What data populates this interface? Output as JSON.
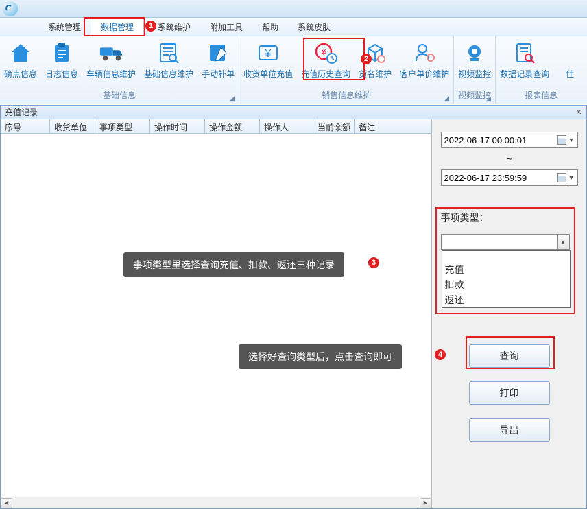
{
  "menubar": {
    "items": [
      {
        "label": "系统管理"
      },
      {
        "label": "数据管理",
        "active": true
      },
      {
        "label": "系统维护"
      },
      {
        "label": "附加工具"
      },
      {
        "label": "帮助"
      },
      {
        "label": "系统皮肤"
      }
    ]
  },
  "ribbon": {
    "groups": [
      {
        "label": "基础信息",
        "items": [
          {
            "label": "磅点信息",
            "icon": "home"
          },
          {
            "label": "日志信息",
            "icon": "clipboard"
          },
          {
            "label": "车辆信息维护",
            "icon": "truck"
          },
          {
            "label": "基础信息维护",
            "icon": "list"
          },
          {
            "label": "手动补单",
            "icon": "edit"
          }
        ]
      },
      {
        "label": "销售信息维护",
        "items": [
          {
            "label": "收货单位充值",
            "icon": "yen"
          },
          {
            "label": "充值历史查询",
            "icon": "yen-clock",
            "highlight": true
          },
          {
            "label": "货名维护",
            "icon": "package"
          },
          {
            "label": "客户单价维护",
            "icon": "person-gear"
          }
        ]
      },
      {
        "label": "视频监控",
        "items": [
          {
            "label": "视频监控",
            "icon": "camera"
          }
        ]
      },
      {
        "label": "报表信息",
        "items": [
          {
            "label": "数据记录查询",
            "icon": "doc-search"
          },
          {
            "label": "仕",
            "icon": "placeholder",
            "partial": true
          }
        ]
      }
    ]
  },
  "panel": {
    "title": "充值记录",
    "columns": [
      {
        "label": "序号",
        "width": 72
      },
      {
        "label": "收货单位",
        "width": 66
      },
      {
        "label": "事项类型",
        "width": 80
      },
      {
        "label": "操作时间",
        "width": 80
      },
      {
        "label": "操作金额",
        "width": 80
      },
      {
        "label": "操作人",
        "width": 78
      },
      {
        "label": "当前余额",
        "width": 60
      },
      {
        "label": "备注",
        "width": 100
      }
    ],
    "rows": []
  },
  "filter": {
    "date_from": "2022-06-17 00:00:01",
    "date_to": "2022-06-17 23:59:59",
    "tilde": "~",
    "type_label": "事项类型：",
    "type_value": "",
    "type_options": [
      "充值",
      "扣款",
      "返还"
    ],
    "query_btn": "查询",
    "print_btn": "打印",
    "export_btn": "导出"
  },
  "annotations": {
    "badge1": "1",
    "badge2": "2",
    "badge3": "3",
    "badge4": "4",
    "callout3": "事项类型里选择查询充值、扣款、返还三种记录",
    "callout4": "选择好查询类型后，点击查询即可"
  }
}
